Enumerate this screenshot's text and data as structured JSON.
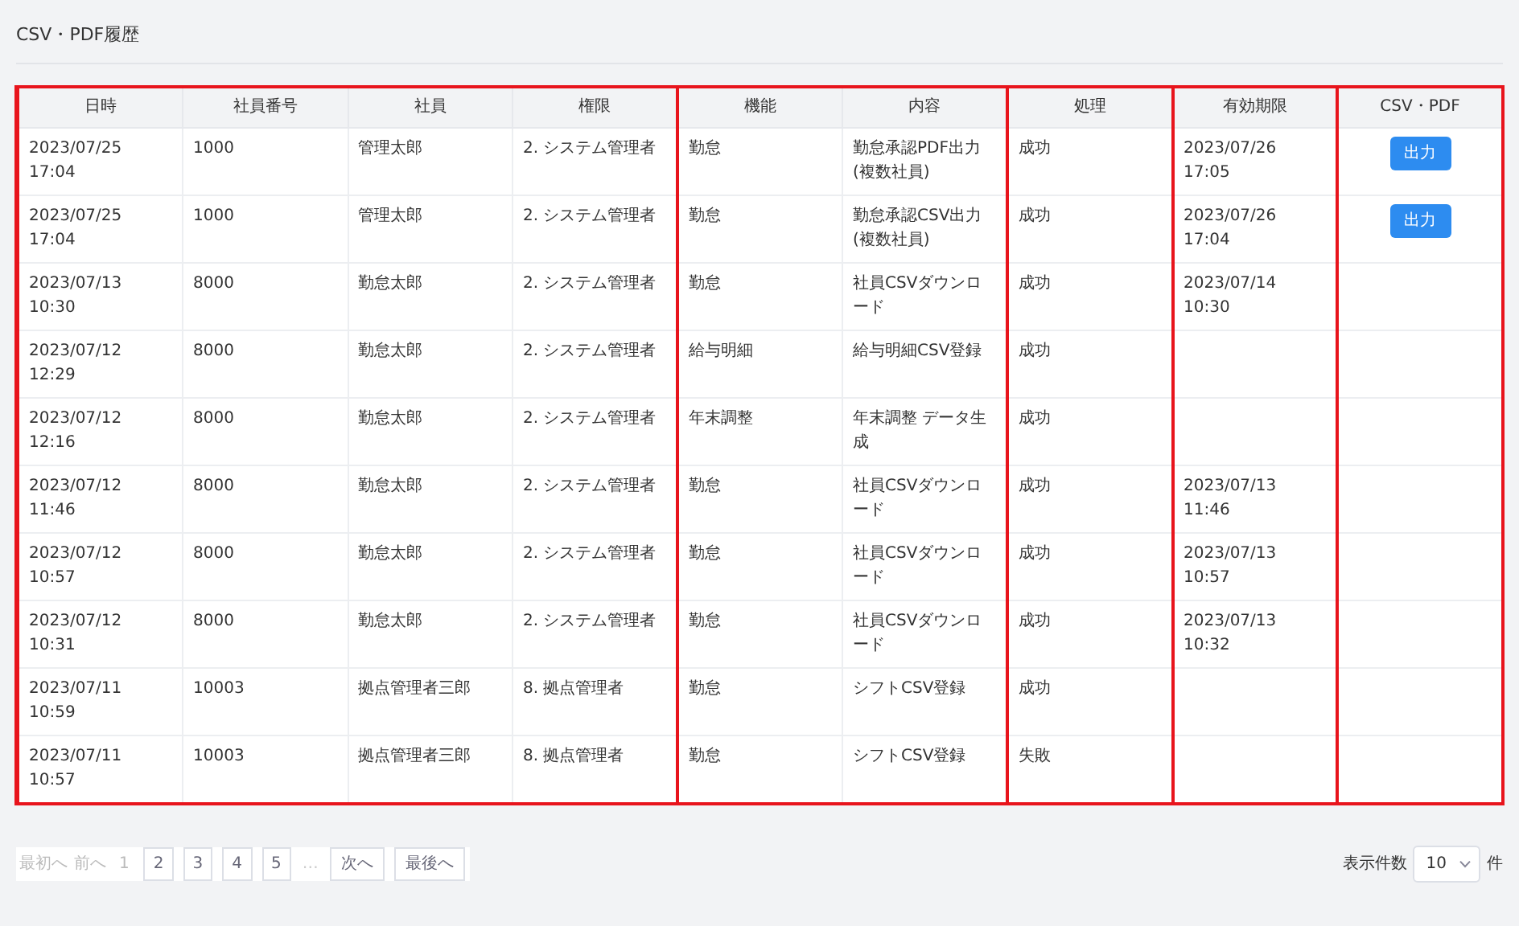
{
  "title": "CSV・PDF履歴",
  "column_groups": [
    {
      "columns": [
        "日時",
        "社員番号",
        "社員",
        "権限"
      ]
    },
    {
      "columns": [
        "機能",
        "内容"
      ]
    },
    {
      "columns": [
        "処理"
      ]
    },
    {
      "columns": [
        "有効期限"
      ]
    },
    {
      "columns": [
        "CSV・PDF"
      ]
    }
  ],
  "rows": [
    {
      "cells": [
        "2023/07/25\n17:04",
        "1000",
        "管理太郎",
        "2. システム管理者",
        "勤怠",
        "勤怠承認PDF出力(複数社員)",
        "成功",
        "2023/07/26\n17:05"
      ],
      "action": "出力"
    },
    {
      "cells": [
        "2023/07/25\n17:04",
        "1000",
        "管理太郎",
        "2. システム管理者",
        "勤怠",
        "勤怠承認CSV出力(複数社員)",
        "成功",
        "2023/07/26\n17:04"
      ],
      "action": "出力"
    },
    {
      "cells": [
        "2023/07/13\n10:30",
        "8000",
        "勤怠太郎",
        "2. システム管理者",
        "勤怠",
        "社員CSVダウンロード",
        "成功",
        "2023/07/14\n10:30"
      ]
    },
    {
      "cells": [
        "2023/07/12\n12:29",
        "8000",
        "勤怠太郎",
        "2. システム管理者",
        "給与明細",
        "給与明細CSV登録",
        "成功",
        ""
      ]
    },
    {
      "cells": [
        "2023/07/12\n12:16",
        "8000",
        "勤怠太郎",
        "2. システム管理者",
        "年末調整",
        "年末調整 データ生成",
        "成功",
        ""
      ]
    },
    {
      "cells": [
        "2023/07/12\n11:46",
        "8000",
        "勤怠太郎",
        "2. システム管理者",
        "勤怠",
        "社員CSVダウンロード",
        "成功",
        "2023/07/13\n11:46"
      ]
    },
    {
      "cells": [
        "2023/07/12\n10:57",
        "8000",
        "勤怠太郎",
        "2. システム管理者",
        "勤怠",
        "社員CSVダウンロード",
        "成功",
        "2023/07/13\n10:57"
      ]
    },
    {
      "cells": [
        "2023/07/12\n10:31",
        "8000",
        "勤怠太郎",
        "2. システム管理者",
        "勤怠",
        "社員CSVダウンロード",
        "成功",
        "2023/07/13\n10:32"
      ]
    },
    {
      "cells": [
        "2023/07/11\n10:59",
        "10003",
        "拠点管理者三郎",
        "8. 拠点管理者",
        "勤怠",
        "シフトCSV登録",
        "成功",
        ""
      ]
    },
    {
      "cells": [
        "2023/07/11\n10:57",
        "10003",
        "拠点管理者三郎",
        "8. 拠点管理者",
        "勤怠",
        "シフトCSV登録",
        "失敗",
        ""
      ]
    }
  ],
  "pagination": [
    {
      "kind": "nav",
      "label": "最初へ",
      "disabled": true
    },
    {
      "kind": "nav",
      "label": "前へ",
      "disabled": true
    },
    {
      "kind": "page",
      "label": "1",
      "selected": true
    },
    {
      "kind": "page",
      "label": "2",
      "selected": false
    },
    {
      "kind": "page",
      "label": "3",
      "selected": false
    },
    {
      "kind": "page",
      "label": "4",
      "selected": false
    },
    {
      "kind": "page",
      "label": "5",
      "selected": false
    },
    {
      "kind": "ellipsis",
      "label": "…"
    },
    {
      "kind": "nav",
      "label": "次へ",
      "disabled": false
    },
    {
      "kind": "nav",
      "label": "最後へ",
      "disabled": false
    }
  ],
  "page_size": {
    "label": "表示件数",
    "value": "10",
    "unit": "件"
  }
}
